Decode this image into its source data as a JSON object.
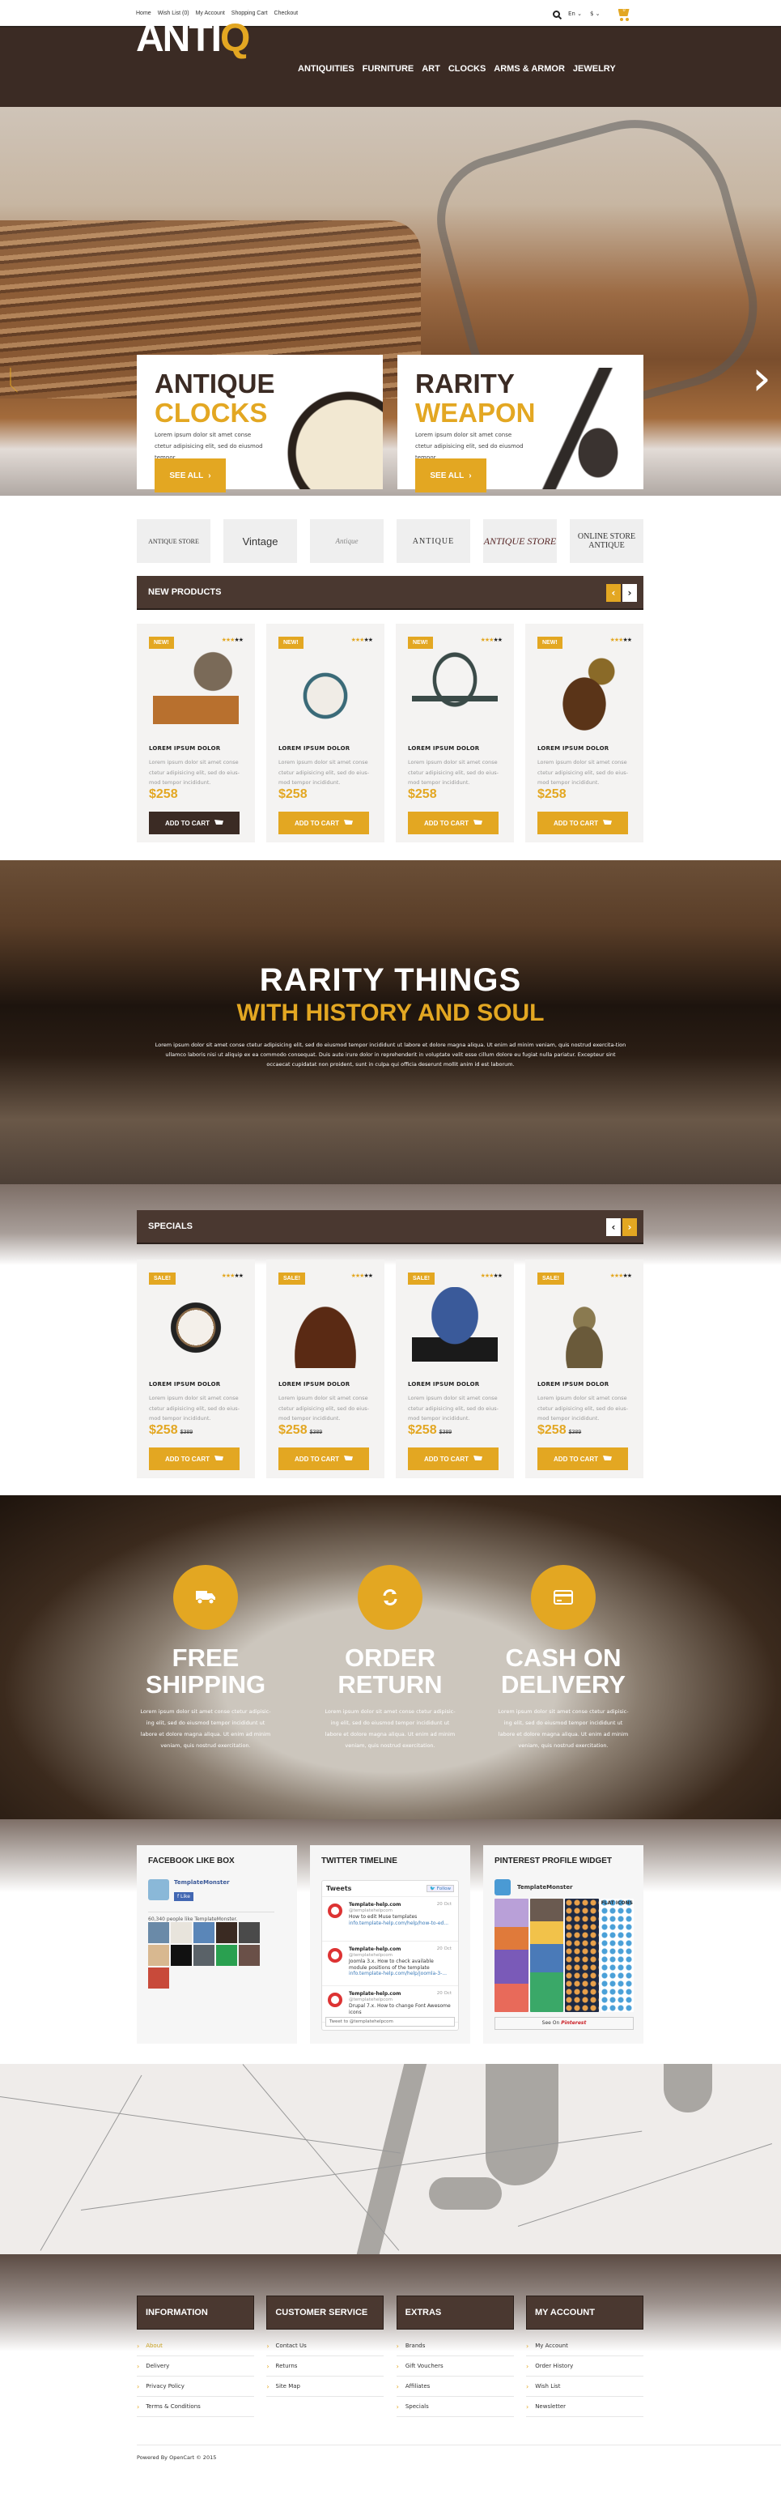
{
  "topbar": {
    "links": [
      "Home",
      "Wish List (0)",
      "My Account",
      "Shopping Cart",
      "Checkout"
    ],
    "language": "En",
    "currency": "$",
    "cart_count": "0",
    "icons": [
      "search-icon",
      "cart-icon"
    ]
  },
  "header": {
    "logo_main": "ANTI",
    "logo_accent": "Q",
    "nav": [
      "ANTIQUITIES",
      "FURNITURE",
      "ART",
      "CLOCKS",
      "ARMS & ARMOR",
      "JEWELRY"
    ]
  },
  "hero": {
    "arrows": [
      "chevron-left-icon",
      "chevron-right-icon"
    ],
    "promos": [
      {
        "title_dark": "ANTIQUE",
        "title_accent": "CLOCKS",
        "text": "Lorem ipsum dolor sit amet conse ctetur adipisicing elit, sed do eiusmod tempor.",
        "button": "SEE ALL",
        "button_icon": "›"
      },
      {
        "title_dark": "RARITY",
        "title_accent": "WEAPON",
        "text": "Lorem ipsum dolor sit amet conse ctetur adipisicing elit, sed do eiusmod tempor.",
        "button": "SEE ALL",
        "button_icon": "›"
      }
    ]
  },
  "brands": [
    "ANTIQUE STORE",
    "Vintage",
    "Antique",
    "ANTIQUE",
    "ANTIQUE STORE",
    "ONLINE STORE ANTIQUE"
  ],
  "new_products": {
    "title": "NEW PRODUCTS",
    "prev": "‹",
    "next": "›",
    "items": [
      {
        "badge": "NEW!",
        "rating": 3,
        "max_rating": 5,
        "name": "LOREM IPSUM DOLOR",
        "desc": "Lorem ipsum dolor sit amet conse ctetur adipisicing elit, sed do eius-mod tempor incididunt.",
        "price": "$258",
        "button": "ADD TO CART",
        "image": "gramophone"
      },
      {
        "badge": "NEW!",
        "rating": 3,
        "max_rating": 5,
        "name": "LOREM IPSUM DOLOR",
        "desc": "Lorem ipsum dolor sit amet conse ctetur adipisicing elit, sed do eius-mod tempor incididunt.",
        "price": "$258",
        "button": "ADD TO CART",
        "image": "pocket-watch-clock"
      },
      {
        "badge": "NEW!",
        "rating": 3,
        "max_rating": 5,
        "name": "LOREM IPSUM DOLOR",
        "desc": "Lorem ipsum dolor sit amet conse ctetur adipisicing elit, sed do eius-mod tempor incididunt.",
        "price": "$258",
        "button": "ADD TO CART",
        "image": "iron-bench"
      },
      {
        "badge": "NEW!",
        "rating": 3,
        "max_rating": 5,
        "name": "LOREM IPSUM DOLOR",
        "desc": "Lorem ipsum dolor sit amet conse ctetur adipisicing elit, sed do eius-mod tempor incididunt.",
        "price": "$258",
        "button": "ADD TO CART",
        "image": "bull-statue"
      }
    ]
  },
  "banner": {
    "title": "RARITY THINGS",
    "subtitle": "WITH HISTORY AND SOUL",
    "text": "Lorem ipsum dolor sit amet conse ctetur adipisicing elit, sed do eiusmod tempor incididunt ut labore et dolore magna aliqua. Ut enim ad minim veniam, quis nostrud exercita-tion ullamco laboris nisi ut aliquip ex ea commodo consequat. Duis aute irure dolor in reprehenderit in voluptate velit esse cillum dolore eu fugiat nulla pariatur. Excepteur sint occaecat cupidatat non proident, sunt in culpa qui officia deserunt mollit anim id est laborum."
  },
  "specials": {
    "title": "SPECIALS",
    "prev": "‹",
    "next": "›",
    "items": [
      {
        "badge": "SALE!",
        "rating": 3,
        "max_rating": 5,
        "name": "LOREM IPSUM DOLOR",
        "desc": "Lorem ipsum dolor sit amet conse ctetur adipisicing elit, sed do eius-mod tempor incididunt.",
        "price": "$258",
        "old_price": "$389",
        "button": "ADD TO CART",
        "image": "wall-clock"
      },
      {
        "badge": "SALE!",
        "rating": 3,
        "max_rating": 5,
        "name": "LOREM IPSUM DOLOR",
        "desc": "Lorem ipsum dolor sit amet conse ctetur adipisicing elit, sed do eius-mod tempor incididunt.",
        "price": "$258",
        "old_price": "$389",
        "button": "ADD TO CART",
        "image": "vintage-radio"
      },
      {
        "badge": "SALE!",
        "rating": 3,
        "max_rating": 5,
        "name": "LOREM IPSUM DOLOR",
        "desc": "Lorem ipsum dolor sit amet conse ctetur adipisicing elit, sed do eius-mod tempor incididunt.",
        "price": "$258",
        "old_price": "$389",
        "button": "ADD TO CART",
        "image": "porcelain-pot"
      },
      {
        "badge": "SALE!",
        "rating": 3,
        "max_rating": 5,
        "name": "LOREM IPSUM DOLOR",
        "desc": "Lorem ipsum dolor sit amet conse ctetur adipisicing elit, sed do eius-mod tempor incididunt.",
        "price": "$258",
        "old_price": "$389",
        "button": "ADD TO CART",
        "image": "bronze-statue"
      }
    ]
  },
  "features": [
    {
      "icon": "truck-icon",
      "title": "FREE SHIPPING",
      "text": "Lorem ipsum dolor sit amet conse ctetur adipisic-ing elit, sed do eiusmod tempor incididunt ut labore et dolore magna aliqua. Ut enim ad minim veniam, quis nostrud exercitation."
    },
    {
      "icon": "refresh-icon",
      "title": "ORDER RETURN",
      "text": "Lorem ipsum dolor sit amet conse ctetur adipisic-ing elit, sed do eiusmod tempor incididunt ut labore et dolore magna aliqua. Ut enim ad minim veniam, quis nostrud exercitation."
    },
    {
      "icon": "credit-card-icon",
      "title": "CASH ON DELIVERY",
      "text": "Lorem ipsum dolor sit amet conse ctetur adipisic-ing elit, sed do eiusmod tempor incididunt ut labore et dolore magna aliqua. Ut enim ad minim veniam, quis nostrud exercitation."
    }
  ],
  "widgets": {
    "facebook": {
      "title": "FACEBOOK LIKE BOX",
      "page": "TemplateMonster",
      "like": "Like",
      "count_text": "60,340 people like TemplateMonster."
    },
    "twitter": {
      "title": "TWITTER TIMELINE",
      "header": "Tweets",
      "follow": "Follow",
      "tweets": [
        {
          "name": "Template-help.com",
          "handle": "@templatehelpcom",
          "date": "20 Oct",
          "text": "How to edit Muse templates",
          "link": "info.template-help.com/help/how-to-ed..."
        },
        {
          "name": "Template-help.com",
          "handle": "@templatehelpcom",
          "date": "20 Oct",
          "text": "Joomla 3.x. How to check available module positions of the template",
          "link": "info.template-help.com/help/joomla-3-..."
        },
        {
          "name": "Template-help.com",
          "handle": "@templatehelpcom",
          "date": "20 Oct",
          "text": "Drupal 7.x. How to change Font Awesome icons",
          "link": ""
        }
      ],
      "tweet_box": "Tweet to @templatehelpcom"
    },
    "pinterest": {
      "title": "PINTEREST PROFILE WIDGET",
      "profile": "TemplateMonster",
      "see_on": "See On",
      "brand": "Pinterest",
      "pin_label": "FLAT ICONS"
    }
  },
  "footer": {
    "columns": [
      {
        "title": "INFORMATION",
        "links": [
          "About",
          "Delivery",
          "Privacy Policy",
          "Terms & Conditions"
        ]
      },
      {
        "title": "CUSTOMER SERVICE",
        "links": [
          "Contact Us",
          "Returns",
          "Site Map"
        ]
      },
      {
        "title": "EXTRAS",
        "links": [
          "Brands",
          "Gift Vouchers",
          "Affiliates",
          "Specials"
        ]
      },
      {
        "title": "MY ACCOUNT",
        "links": [
          "My Account",
          "Order History",
          "Wish List",
          "Newsletter"
        ]
      }
    ],
    "active_link": "About",
    "copyright": "Powered By OpenCart  © 2015"
  },
  "colors": {
    "accent": "#e3a722",
    "brown": "#3b2b24",
    "panel": "#4a3830",
    "card": "#f4f3f2"
  }
}
